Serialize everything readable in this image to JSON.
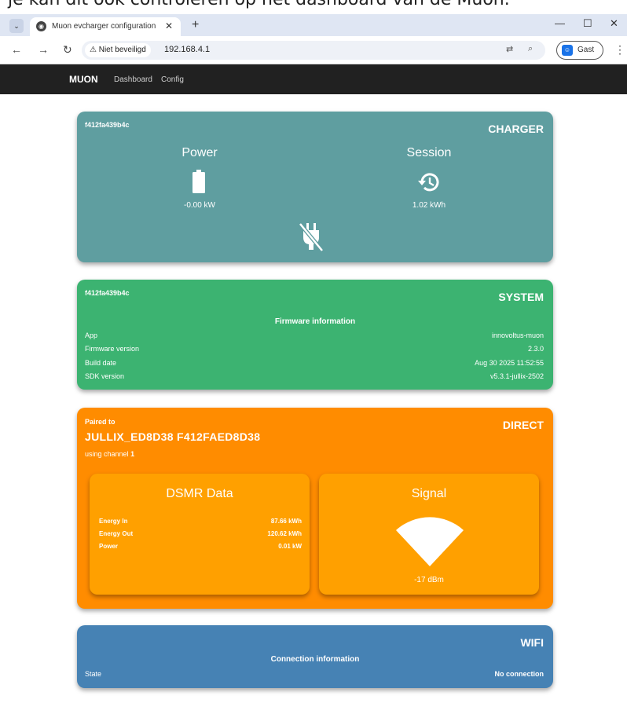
{
  "caption": "je kan dit ook controleren op het dashboard van de Muon.",
  "browser": {
    "tab_title": "Muon evcharger configuration",
    "tab_close": "✕",
    "new_tab": "+",
    "security_label": "⚠ Niet beveiligd",
    "url": "192.168.4.1",
    "profile_label": "Gast",
    "window_minimize": "—",
    "window_maximize": "☐",
    "window_close": "✕"
  },
  "appnav": {
    "brand": "MUON",
    "links": [
      "Dashboard",
      "Config"
    ]
  },
  "charger": {
    "device_id": "f412fa439b4c",
    "heading": "CHARGER",
    "power_label": "Power",
    "power_value": "-0.00 kW",
    "session_label": "Session",
    "session_value": "1.02 kWh"
  },
  "system": {
    "device_id": "f412fa439b4c",
    "heading": "SYSTEM",
    "section_title": "Firmware information",
    "rows": [
      {
        "key": "App",
        "value": "innovoltus-muon"
      },
      {
        "key": "Firmware version",
        "value": "2.3.0"
      },
      {
        "key": "Build date",
        "value": "Aug 30 2025 11:52:55"
      },
      {
        "key": "SDK version",
        "value": "v5.3.1-jullix-2502"
      }
    ]
  },
  "direct": {
    "heading": "DIRECT",
    "paired_label": "Paired to",
    "peer": "JULLIX_ED8D38 F412FAED8D38",
    "channel_text": "using channel",
    "channel_num": "1",
    "dsmr": {
      "title": "DSMR Data",
      "rows": [
        {
          "key": "Energy In",
          "value": "87.66 kWh"
        },
        {
          "key": "Energy Out",
          "value": "120.62 kWh"
        },
        {
          "key": "Power",
          "value": "0.01 kW"
        }
      ]
    },
    "signal": {
      "title": "Signal",
      "value": "-17 dBm"
    }
  },
  "wifi": {
    "heading": "WIFI",
    "section_title": "Connection information",
    "state_key": "State",
    "state_value": "No connection"
  },
  "colors": {
    "charger": "#5f9ea0",
    "system": "#3cb371",
    "direct": "#ff8c00",
    "direct_inner": "#ffa000",
    "wifi": "#4682b4",
    "appnav": "#212121"
  },
  "icons": [
    "battery-icon",
    "history-icon",
    "unplugged-icon",
    "wifi-signal-icon"
  ]
}
